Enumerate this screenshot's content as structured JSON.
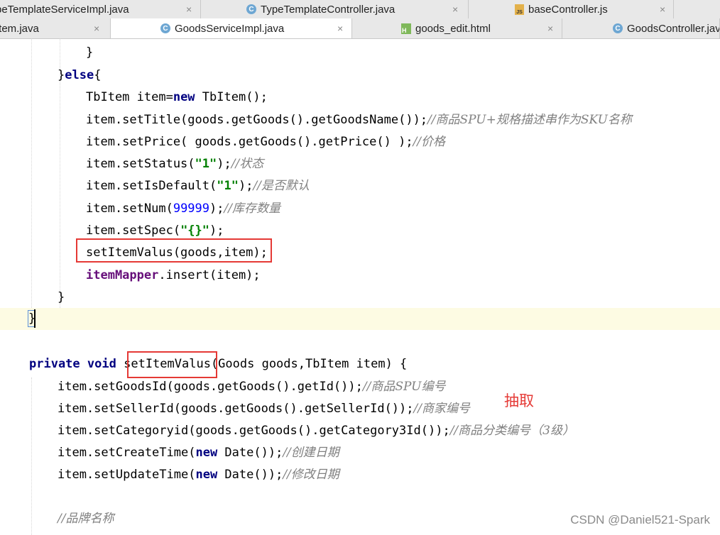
{
  "tabs_row1": [
    {
      "label": "peTemplateServiceImpl.java",
      "icon": "none"
    },
    {
      "label": "TypeTemplateController.java",
      "icon": "java-class-icon"
    },
    {
      "label": "baseController.js",
      "icon": "js-file-icon"
    }
  ],
  "tabs_row2": [
    {
      "label": "Item.java",
      "icon": "none"
    },
    {
      "label": "GoodsServiceImpl.java",
      "icon": "java-class-icon",
      "active": true
    },
    {
      "label": "goods_edit.html",
      "icon": "html-file-icon"
    },
    {
      "label": "GoodsController.java",
      "icon": "java-class-icon"
    }
  ],
  "tab_close_symbol": "×",
  "class_icon_letter": "C",
  "js_icon_label": "JS",
  "html_icon_label": "H",
  "code": {
    "l1": "}",
    "l2_brace": "}",
    "l2_else": "else",
    "l2_open": "{",
    "l3_a": "TbItem item=",
    "l3_new": "new",
    "l3_b": " TbItem();",
    "l4_code": "item.setTitle(goods.getGoods().getGoodsName());",
    "l4_cmt": "//商品SPU+规格描述串作为SKU名称",
    "l5_code": "item.setPrice( goods.getGoods().getPrice() );",
    "l5_cmt": "//价格",
    "l6_a": "item.setStatus(",
    "l6_str": "\"1\"",
    "l6_b": ");",
    "l6_cmt": "//状态",
    "l7_a": "item.setIsDefault(",
    "l7_str": "\"1\"",
    "l7_b": ");",
    "l7_cmt": "//是否默认",
    "l8_a": "item.setNum(",
    "l8_num": "99999",
    "l8_b": ");",
    "l8_cmt": "//库存数量",
    "l9_a": "item.setSpec(",
    "l9_str": "\"{}\"",
    "l9_b": ");",
    "l10": "setItemValus(goods,item);",
    "l11_fld": "itemMapper",
    "l11_b": ".insert(item);",
    "l12": "}",
    "l13": "}",
    "l14_private": "private",
    "l14_void": "void",
    "l14_name": "setItemValus",
    "l14_rest": "(Goods goods,TbItem item) {",
    "l15_code": "item.setGoodsId(goods.getGoods().getId());",
    "l15_cmt": "//商品SPU编号",
    "l16_code": "item.setSellerId(goods.getGoods().getSellerId());",
    "l16_cmt": "//商家编号",
    "l17_code": "item.setCategoryid(goods.getGoods().getCategory3Id());",
    "l17_cmt": "//商品分类编号（3级）",
    "l18_a": "item.setCreateTime(",
    "l18_new": "new",
    "l18_b": " Date());",
    "l18_cmt": "//创建日期",
    "l19_a": "item.setUpdateTime(",
    "l19_new": "new",
    "l19_b": " Date());",
    "l19_cmt": "//修改日期",
    "l20_cmt": "//品牌名称"
  },
  "annotation": "抽取",
  "watermark": "CSDN @Daniel521-Spark",
  "colors": {
    "keyword": "#000080",
    "string": "#008000",
    "number": "#0000ff",
    "comment": "#808080",
    "field": "#660e7a",
    "highlight_box": "#e53935",
    "current_line": "#fdfbe3"
  }
}
